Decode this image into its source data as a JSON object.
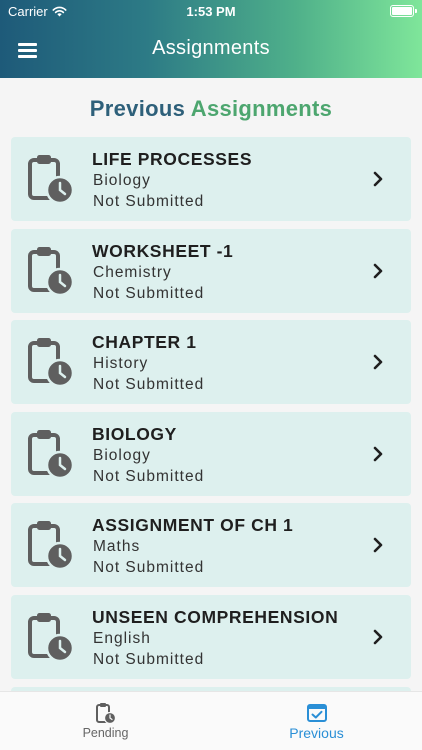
{
  "status_bar": {
    "carrier": "Carrier",
    "time": "1:53 PM"
  },
  "app_bar": {
    "title": "Assignments",
    "menu_icon": "hamburger-menu-icon"
  },
  "section": {
    "title_part1": "Previous",
    "title_part2": "Assignments",
    "colors": {
      "part1": "#2e607a",
      "part2": "#4da66f"
    }
  },
  "assignments": [
    {
      "title": "LIFE PROCESSES",
      "subject": "Biology",
      "status": "Not Submitted",
      "icon": "clipboard-clock-icon"
    },
    {
      "title": "WORKSHEET -1",
      "subject": "Chemistry",
      "status": "Not Submitted",
      "icon": "clipboard-clock-icon"
    },
    {
      "title": "CHAPTER 1",
      "subject": "History",
      "status": "Not Submitted",
      "icon": "clipboard-clock-icon"
    },
    {
      "title": "BIOLOGY",
      "subject": "Biology",
      "status": "Not Submitted",
      "icon": "clipboard-clock-icon"
    },
    {
      "title": "ASSIGNMENT OF CH 1",
      "subject": "Maths",
      "status": "Not Submitted",
      "icon": "clipboard-clock-icon"
    },
    {
      "title": "UNSEEN COMPREHENSION",
      "subject": "English",
      "status": "Not Submitted",
      "icon": "clipboard-clock-icon"
    }
  ],
  "tabs": [
    {
      "label": "Pending",
      "icon": "clipboard-clock-icon",
      "active": false
    },
    {
      "label": "Previous",
      "icon": "calendar-check-icon",
      "active": true
    }
  ],
  "colors": {
    "card_background": "#ddf0ee",
    "active_tab": "#2a8fd6",
    "header_gradient_start": "#1e5a79",
    "header_gradient_end": "#7fe69a"
  }
}
